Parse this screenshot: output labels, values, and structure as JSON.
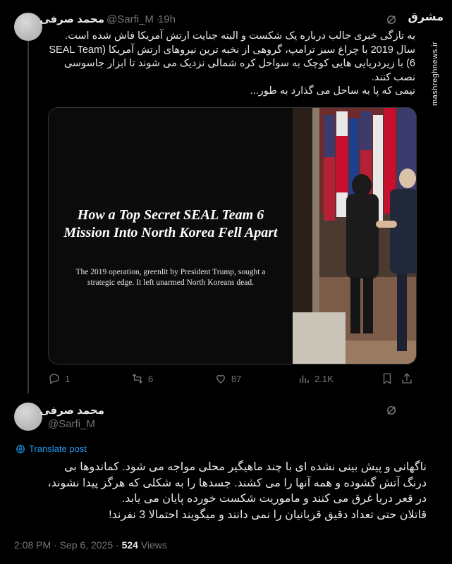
{
  "tweet1": {
    "author_name": "محمد صرفی",
    "handle": "@Sarfi_M",
    "time": "19h",
    "lines": [
      "به تازگی خبری جالب درباره یک شکست و البته جنایت ارتش آمریکا فاش شده است.",
      "سال 2019 با چراغ سبز ترامپ، گروهی از نخبه ترین نیروهای ارتش آمریکا (SEAL Team",
      "6) با زیردریایی هایی کوچک به سواحل کره شمالی نزدیک می شوند تا ابزار جاسوسی",
      "نصب کنند.",
      "تیمی که پا به ساحل می گذارد به طور..."
    ],
    "media": {
      "headline": "How a Top Secret SEAL Team 6 Mission Into North Korea Fell Apart",
      "subhead": "The 2019 operation, greenlit by President Trump, sought a strategic edge. It left unarmed North Koreans dead."
    },
    "actions": {
      "replies": "1",
      "reposts": "6",
      "likes": "87",
      "views": "2.1K"
    }
  },
  "tweet2": {
    "author_name": "محمد صرفی",
    "handle": "@Sarfi_M",
    "translate_label": "Translate post",
    "lines": [
      "ناگهانی و پیش بینی نشده ای با چند ماهیگیر محلی مواجه می شود. کماندوها بی",
      "درنگ آتش گشوده و همه آنها را می کشند. جسدها را به شکلی که هرگز پیدا نشوند،",
      "در قعر دریا غرق می کنند و ماموریت شکست خورده پایان می یابد.",
      "قاتلان حتی تعداد دقیق قربانیان را نمی دانند و میگویند احتمالا 3 نفرند!"
    ],
    "time": "2:08 PM",
    "date": "Sep 6, 2025",
    "views_count": "524",
    "views_label": "Views"
  },
  "watermark": {
    "logo": "مشرق",
    "site": "mashreghnews.ir"
  },
  "colors": {
    "accent": "#1d9bf0",
    "muted": "#71767b",
    "text": "#e7e9ea",
    "bg": "#000000"
  }
}
